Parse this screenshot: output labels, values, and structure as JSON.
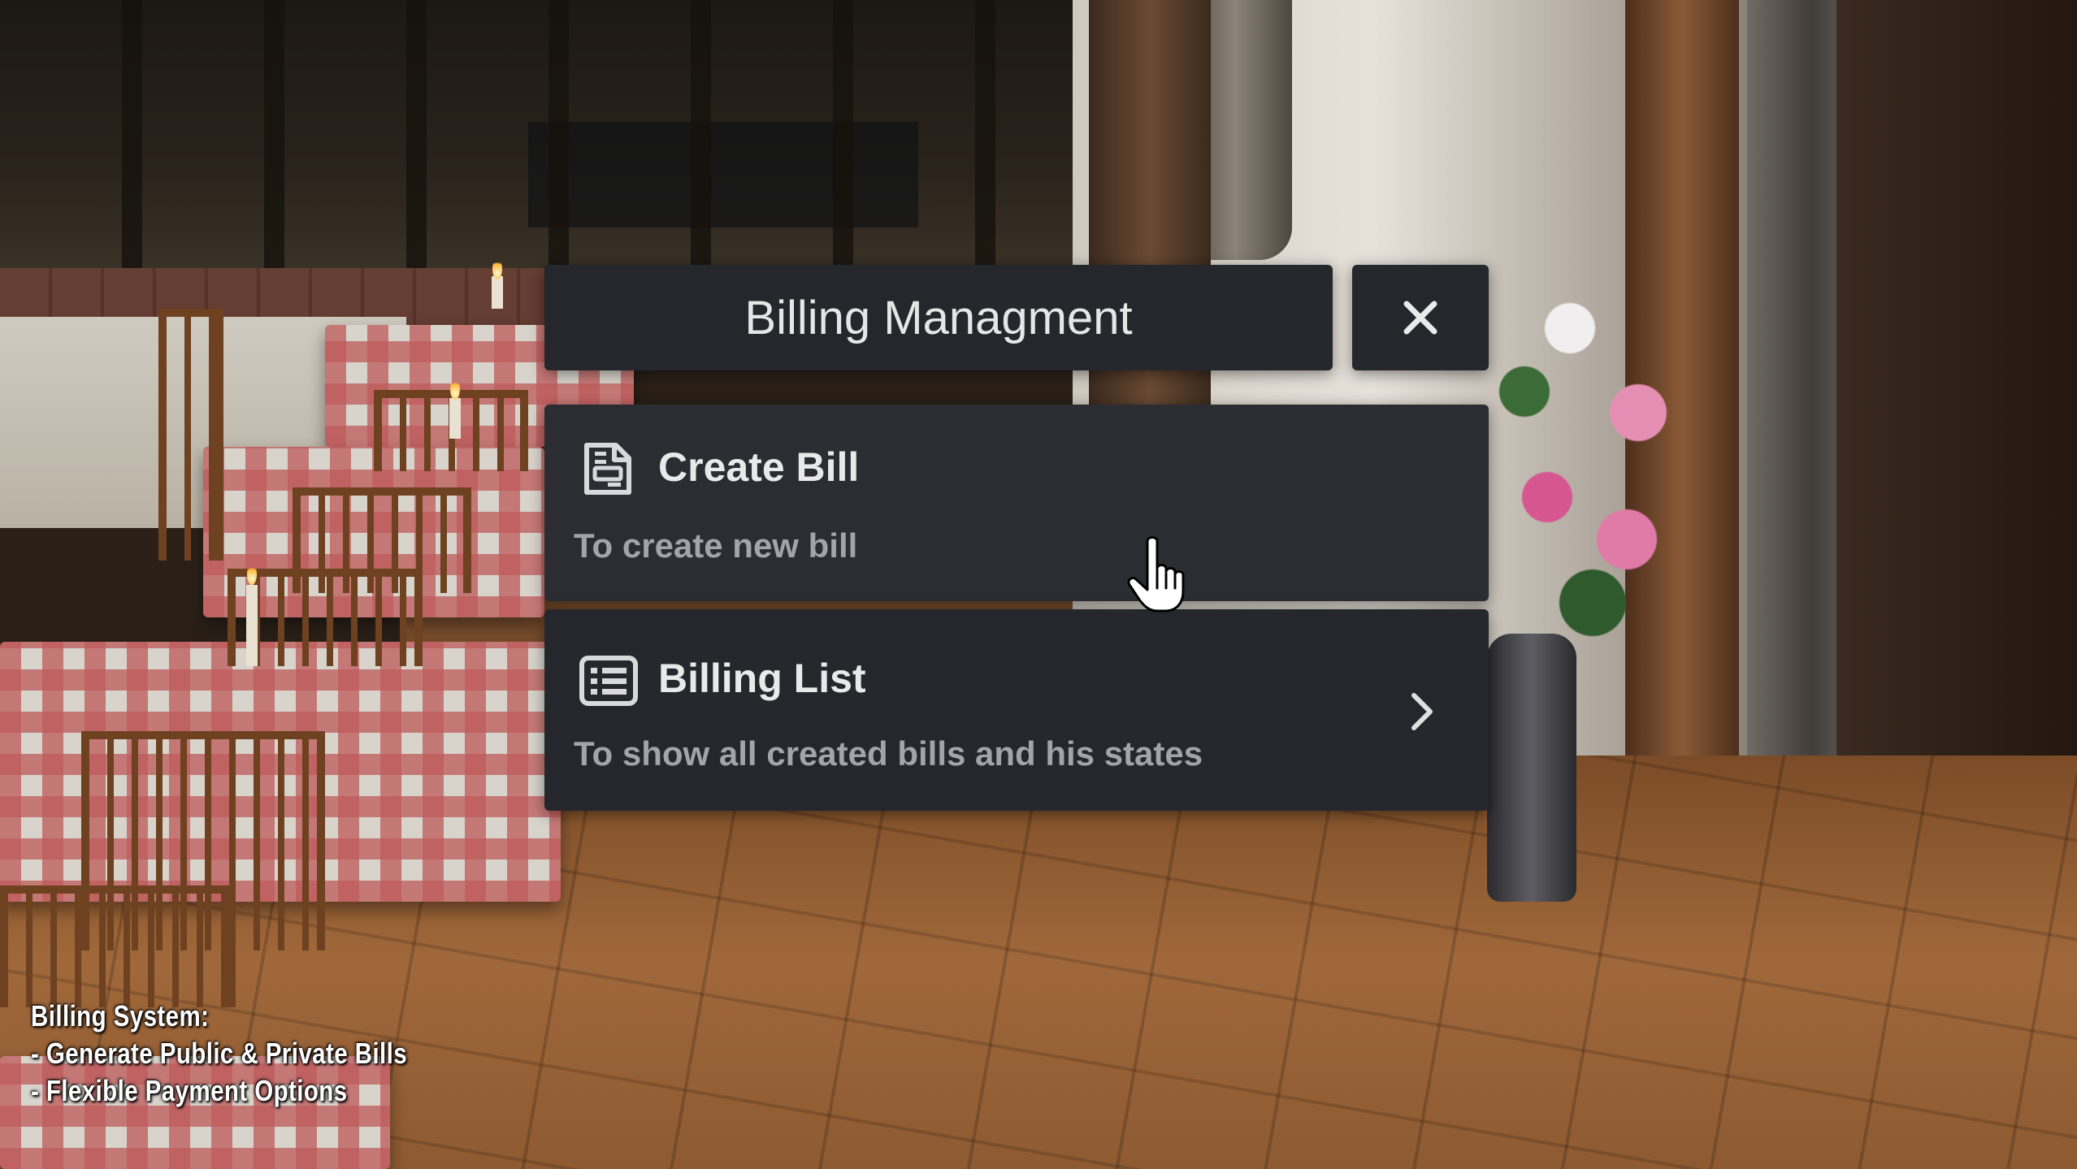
{
  "dialog": {
    "title": "Billing Managment",
    "close_icon": "close-icon"
  },
  "options": [
    {
      "icon": "bill-document-icon",
      "title": "Create Bill",
      "description": "To create new bill"
    },
    {
      "icon": "list-icon",
      "title": "Billing List",
      "description": "To show all created bills and his states",
      "chevron_icon": "chevron-right-icon"
    }
  ],
  "caption": {
    "line1": "Billing System:",
    "line2": "- Generate Public & Private Bills",
    "line3": "- Flexible Payment Options"
  },
  "colors": {
    "panel_bg": "#25272c",
    "panel_hover_bg": "#2b2d33",
    "title_text": "#e6e6e6",
    "desc_text": "#a3a4a9"
  }
}
